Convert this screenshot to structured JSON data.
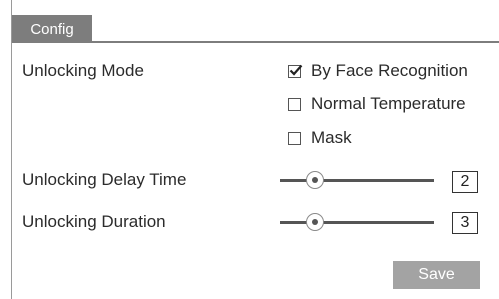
{
  "tab": {
    "label": "Config"
  },
  "unlocking_mode": {
    "label": "Unlocking Mode",
    "options": [
      {
        "label": "By Face Recognition",
        "checked": true
      },
      {
        "label": "Normal Temperature",
        "checked": false
      },
      {
        "label": "Mask",
        "checked": false
      }
    ]
  },
  "delay_time": {
    "label": "Unlocking Delay Time",
    "value": "2"
  },
  "duration": {
    "label": "Unlocking Duration",
    "value": "3"
  },
  "save_label": "Save",
  "colors": {
    "tab_bg": "#7d7d7d",
    "button_bg": "#a3a3a3"
  }
}
